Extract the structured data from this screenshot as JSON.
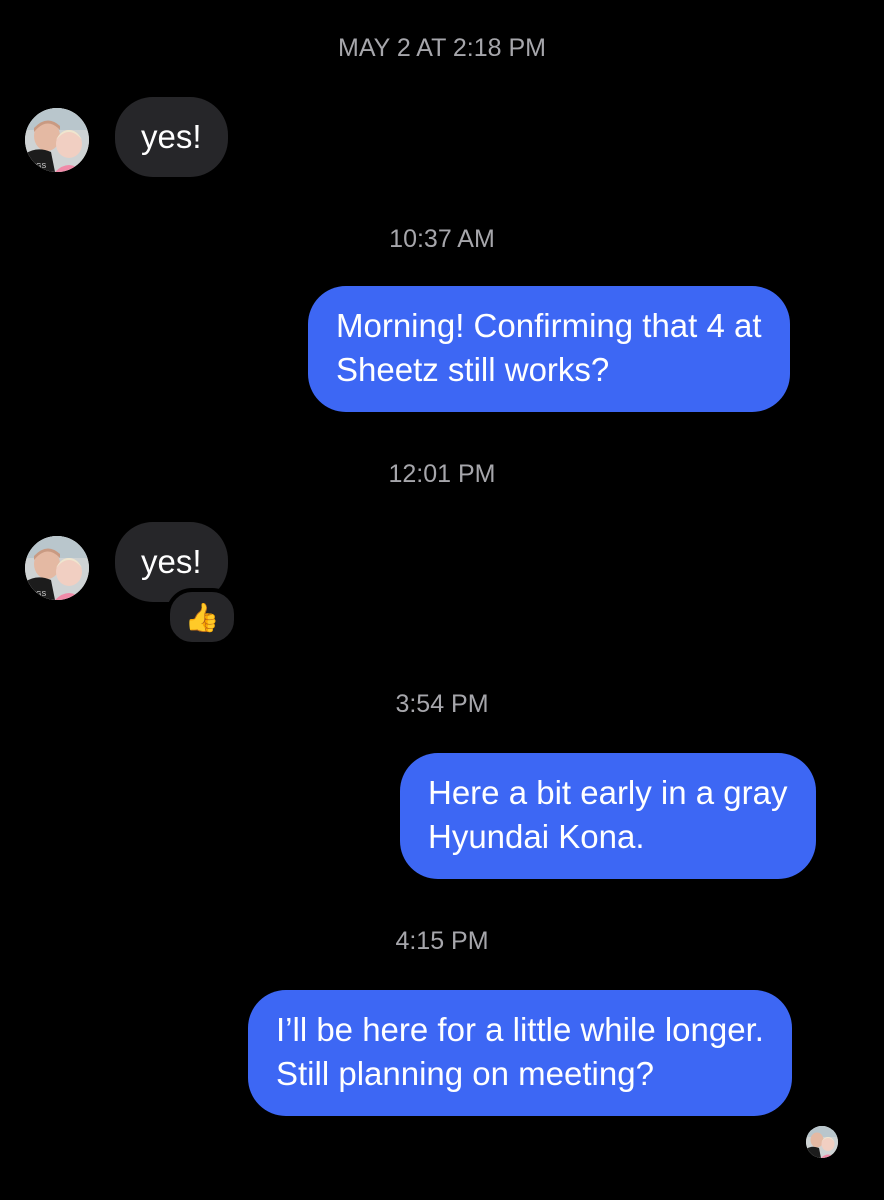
{
  "thread": {
    "items": [
      {
        "kind": "timestamp",
        "text": "MAY 2 AT 2:18 PM"
      },
      {
        "kind": "incoming",
        "text": "yes!"
      },
      {
        "kind": "timestamp",
        "text": "10:37 AM"
      },
      {
        "kind": "outgoing",
        "text": "Morning! Confirming that 4 at\nSheetz still works?"
      },
      {
        "kind": "timestamp",
        "text": "12:01 PM"
      },
      {
        "kind": "incoming",
        "text": "yes!",
        "reaction": "👍"
      },
      {
        "kind": "timestamp",
        "text": "3:54 PM"
      },
      {
        "kind": "outgoing",
        "text": "Here a bit early in a gray\nHyundai Kona."
      },
      {
        "kind": "timestamp",
        "text": "4:15 PM"
      },
      {
        "kind": "outgoing",
        "text": "I’ll be here for a little while longer.\nStill planning on meeting?"
      }
    ]
  },
  "icons": {
    "contact_avatar": "contact-photo-avatar",
    "read_receipt": "contact-photo-read-receipt",
    "reaction": "thumbs-up-icon"
  },
  "colors": {
    "background": "#000000",
    "incoming_bubble": "#262629",
    "outgoing_bubble": "#3d67f4",
    "timestamp": "#a6a6ab"
  }
}
